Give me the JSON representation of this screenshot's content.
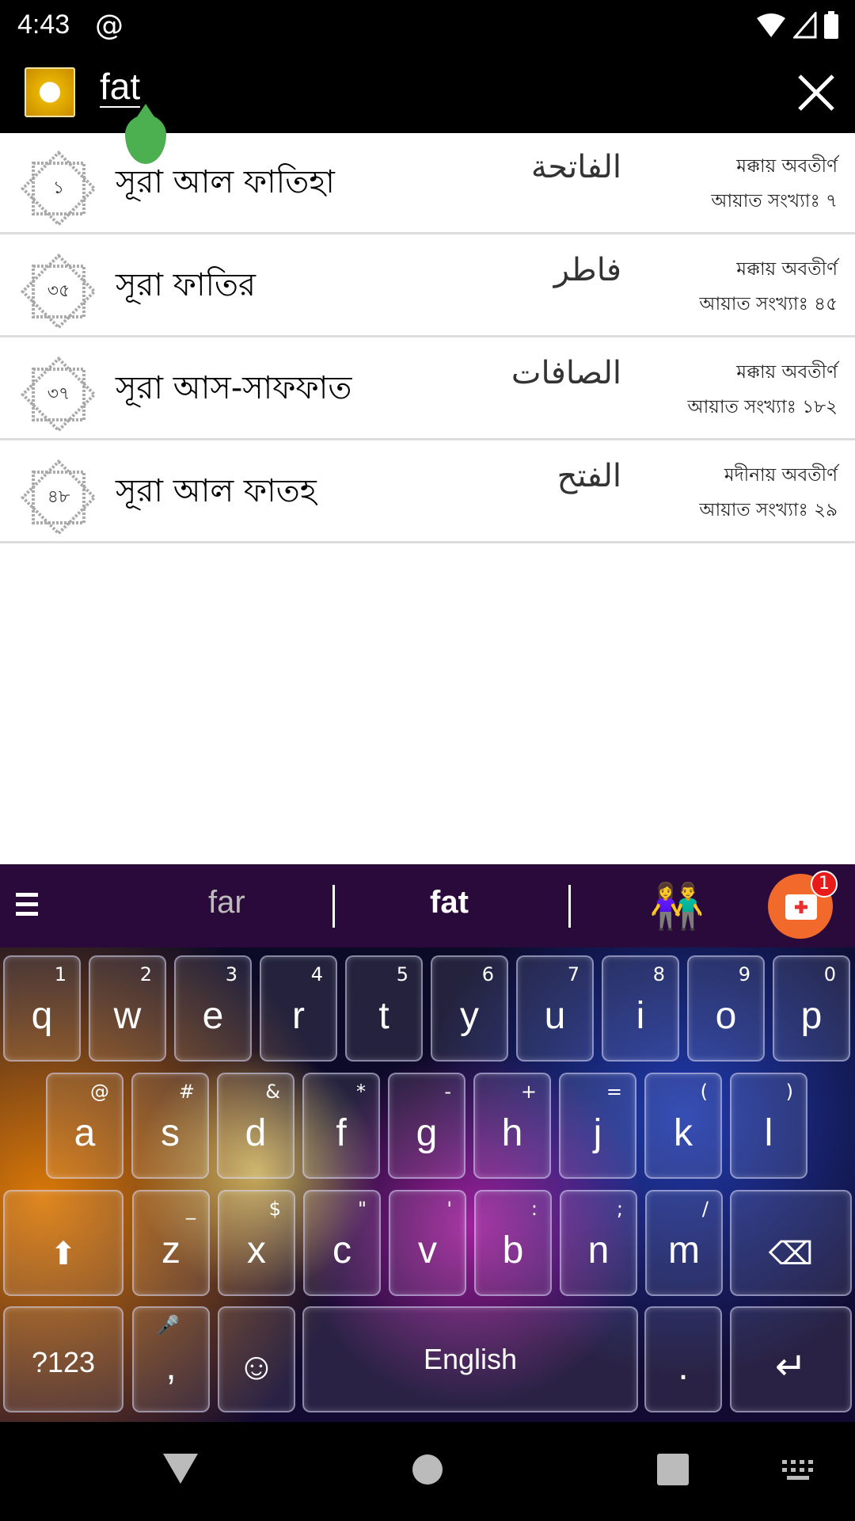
{
  "status": {
    "time": "4:43"
  },
  "search": {
    "query": "fat"
  },
  "results": [
    {
      "number": "১",
      "name": "সূরা আল ফাতিহা",
      "arabic": "الفاتحة",
      "revelation": "মক্কায় অবতীর্ণ",
      "verses": "আয়াত সংখ্যাঃ ৭"
    },
    {
      "number": "৩৫",
      "name": "সূরা ফাতির",
      "arabic": "فاطر",
      "revelation": "মক্কায় অবতীর্ণ",
      "verses": "আয়াত সংখ্যাঃ ৪৫"
    },
    {
      "number": "৩৭",
      "name": "সূরা আস-সাফফাত",
      "arabic": "الصافات",
      "revelation": "মক্কায় অবতীর্ণ",
      "verses": "আয়াত সংখ্যাঃ ১৮২"
    },
    {
      "number": "৪৮",
      "name": "সূরা আল ফাতহ",
      "arabic": "الفتح",
      "revelation": "মদীনায় অবতীর্ণ",
      "verses": "আয়াত সংখ্যাঃ ২৯"
    }
  ],
  "keyboard": {
    "suggestions": [
      "far",
      "fat"
    ],
    "notification_count": "1",
    "rows": [
      [
        [
          "q",
          "1"
        ],
        [
          "w",
          "2"
        ],
        [
          "e",
          "3"
        ],
        [
          "r",
          "4"
        ],
        [
          "t",
          "5"
        ],
        [
          "y",
          "6"
        ],
        [
          "u",
          "7"
        ],
        [
          "i",
          "8"
        ],
        [
          "o",
          "9"
        ],
        [
          "p",
          "0"
        ]
      ],
      [
        [
          "a",
          "@"
        ],
        [
          "s",
          "#"
        ],
        [
          "d",
          "&"
        ],
        [
          "f",
          "*"
        ],
        [
          "g",
          "-"
        ],
        [
          "h",
          "+"
        ],
        [
          "j",
          "="
        ],
        [
          "k",
          "("
        ],
        [
          "l",
          ")"
        ]
      ],
      [
        [
          "z",
          "_"
        ],
        [
          "x",
          "$"
        ],
        [
          "c",
          "\""
        ],
        [
          "v",
          "'"
        ],
        [
          "b",
          ":"
        ],
        [
          "n",
          ";"
        ],
        [
          "m",
          "/"
        ]
      ]
    ],
    "symbols_label": "?123",
    "comma": ",",
    "space_label": "English",
    "period": "."
  }
}
